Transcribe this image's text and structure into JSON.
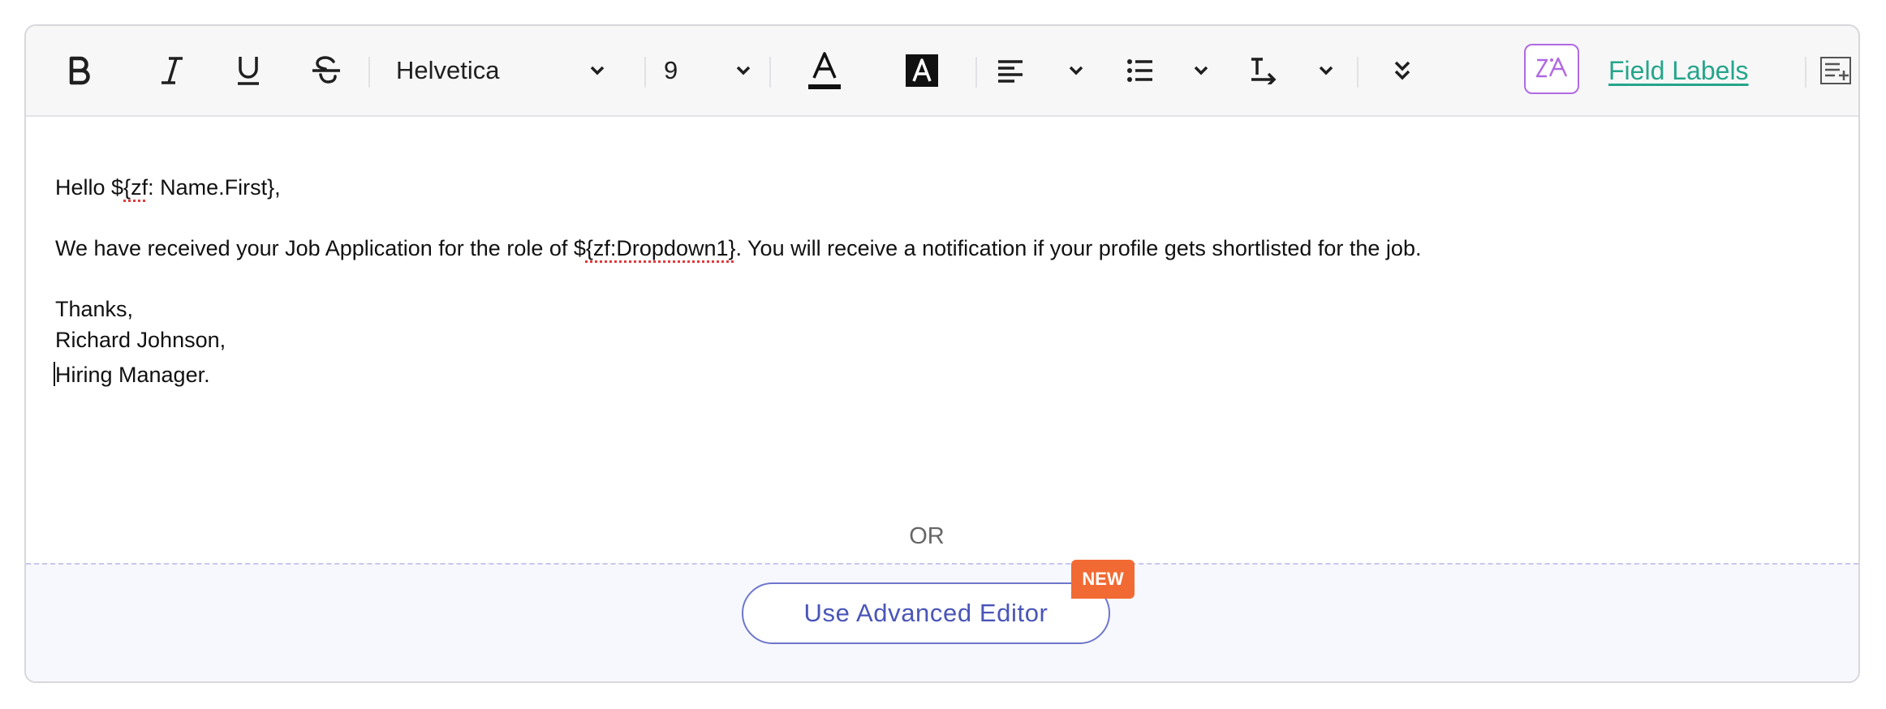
{
  "toolbar": {
    "font_family": "Helvetica",
    "font_size": "9",
    "field_labels": "Field Labels",
    "icons": [
      "bold-icon",
      "italic-icon",
      "underline-icon",
      "strikethrough-icon",
      "chevron-down-icon",
      "text-color-icon",
      "highlight-color-icon",
      "align-left-icon",
      "list-icon",
      "text-direction-icon",
      "double-chevron-down-icon",
      "ai-assist-icon",
      "insert-field-icon"
    ],
    "ai_accent": "#b06ae2",
    "link_color": "#26a58a"
  },
  "content": {
    "greeting_prefix": "Hello $",
    "greeting_field": "{zf",
    "greeting_rest": ": Name.First},",
    "body_prefix": "We have received your Job Application for the role of $",
    "body_field": "{zf:Dropdown1}",
    "body_rest": ". You will receive a notification if your profile gets shortlisted for the job.",
    "closing": "Thanks,",
    "signature_name": "Richard Johnson,",
    "signature_title": "Hiring Manager."
  },
  "footer": {
    "or_label": "OR",
    "advanced_button": "Use Advanced Editor",
    "new_badge": "NEW",
    "badge_color": "#f26a33",
    "button_color": "#4a55b8"
  }
}
